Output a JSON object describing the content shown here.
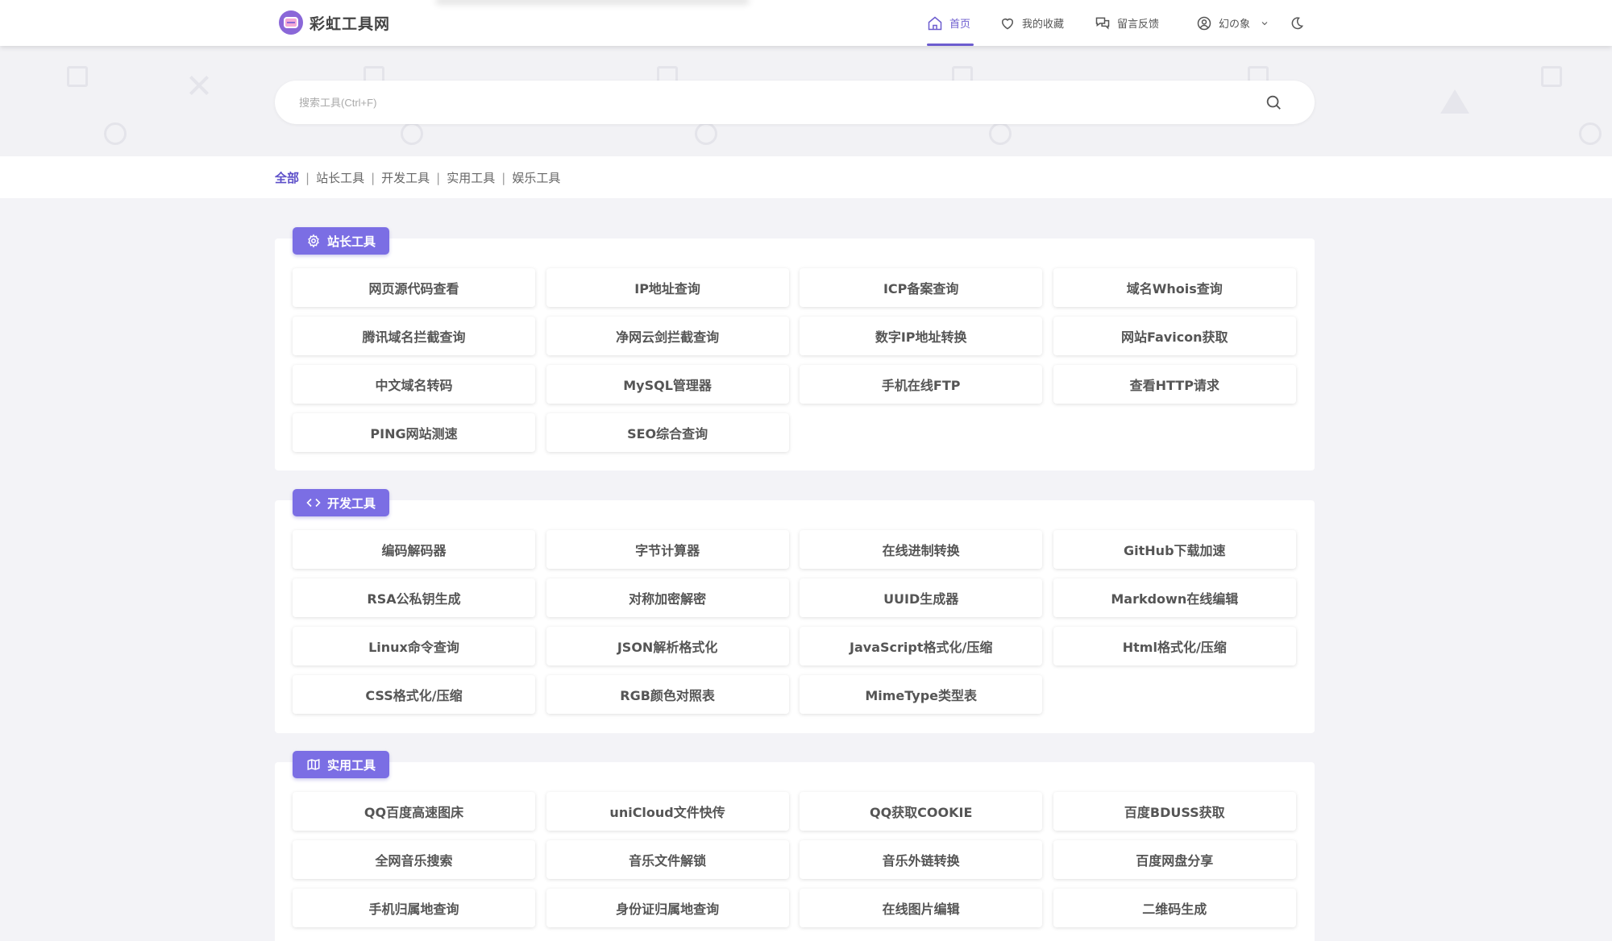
{
  "header": {
    "brand_name": "彩虹工具网",
    "nav": {
      "home": "首页",
      "favorites": "我的收藏",
      "feedback": "留言反馈",
      "user": "幻の象"
    }
  },
  "search": {
    "placeholder": "搜索工具(Ctrl+F)"
  },
  "filters": [
    "全部",
    "站长工具",
    "开发工具",
    "实用工具",
    "娱乐工具"
  ],
  "colors": {
    "accent": "#7b6ee4",
    "accent_text": "#5d4fc9"
  },
  "sections": [
    {
      "title": "站长工具",
      "icon": "gear-icon",
      "tools": [
        "网页源代码查看",
        "IP地址查询",
        "ICP备案查询",
        "域名Whois查询",
        "腾讯域名拦截查询",
        "净网云剑拦截查询",
        "数字IP地址转换",
        "网站Favicon获取",
        "中文域名转码",
        "MySQL管理器",
        "手机在线FTP",
        "查看HTTP请求",
        "PING网站测速",
        "SEO综合查询"
      ]
    },
    {
      "title": "开发工具",
      "icon": "code-icon",
      "tools": [
        "编码解码器",
        "字节计算器",
        "在线进制转换",
        "GitHub下载加速",
        "RSA公私钥生成",
        "对称加密解密",
        "UUID生成器",
        "Markdown在线编辑",
        "Linux命令查询",
        "JSON解析格式化",
        "JavaScript格式化/压缩",
        "Html格式化/压缩",
        "CSS格式化/压缩",
        "RGB颜色对照表",
        "MimeType类型表"
      ]
    },
    {
      "title": "实用工具",
      "icon": "map-icon",
      "tools": [
        "QQ百度高速图床",
        "uniCloud文件快传",
        "QQ获取COOKIE",
        "百度BDUSS获取",
        "全网音乐搜索",
        "音乐文件解锁",
        "音乐外链转换",
        "百度网盘分享",
        "手机归属地查询",
        "身份证归属地查询",
        "在线图片编辑",
        "二维码生成"
      ]
    }
  ]
}
